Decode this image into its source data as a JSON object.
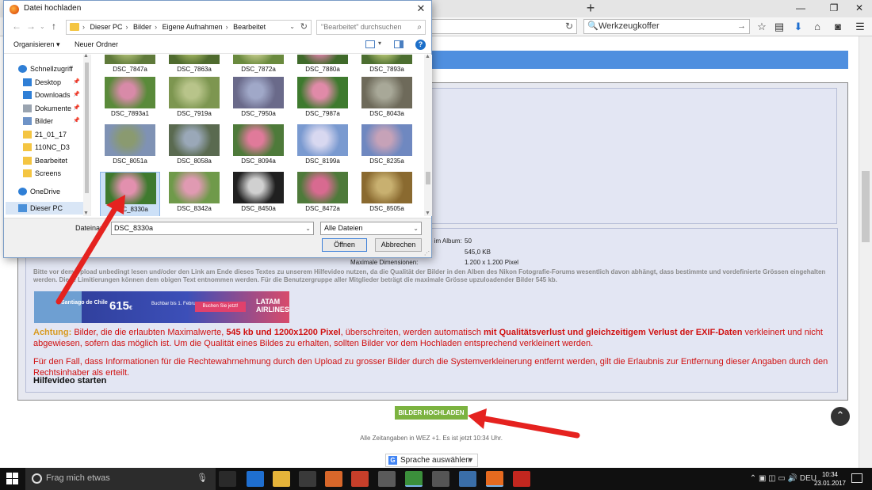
{
  "browser": {
    "new_tab_label": "+",
    "search_text": "Werkzeugkoffer",
    "window_controls": {
      "minimize": "—",
      "maximize": "❐",
      "close": "✕"
    }
  },
  "dialog": {
    "title": "Datei hochladen",
    "close_label": "✕",
    "breadcrumb": [
      "Dieser PC",
      "Bilder",
      "Eigene Aufnahmen",
      "Bearbeitet"
    ],
    "search_placeholder": "\"Bearbeitet\" durchsuchen",
    "toolbar": {
      "organize": "Organisieren ▾",
      "new_folder": "Neuer Ordner",
      "help": "?"
    },
    "nav_items": [
      {
        "label": "Schnellzugriff",
        "icon": "star-icon",
        "color": "#2f7fd6",
        "pinned": false
      },
      {
        "label": "Desktop",
        "icon": "desktop-icon",
        "color": "#2f7fd6",
        "pinned": true
      },
      {
        "label": "Downloads",
        "icon": "download-icon",
        "color": "#2f7fd6",
        "pinned": true
      },
      {
        "label": "Dokumente",
        "icon": "document-icon",
        "color": "#9aa4b0",
        "pinned": true
      },
      {
        "label": "Bilder",
        "icon": "pictures-icon",
        "color": "#6e93c7",
        "pinned": true
      },
      {
        "label": "21_01_17",
        "icon": "folder-icon",
        "color": "#f4c542",
        "pinned": false
      },
      {
        "label": "110NC_D3",
        "icon": "folder-icon",
        "color": "#f4c542",
        "pinned": false
      },
      {
        "label": "Bearbeitet",
        "icon": "folder-icon",
        "color": "#f4c542",
        "pinned": false
      },
      {
        "label": "Screens",
        "icon": "folder-icon",
        "color": "#f4c542",
        "pinned": false
      },
      {
        "label": "OneDrive",
        "icon": "cloud-icon",
        "color": "#2f7fd6",
        "pinned": false
      },
      {
        "label": "Dieser PC",
        "icon": "computer-icon",
        "color": "#4a90d9",
        "pinned": false
      }
    ],
    "files": [
      {
        "name": "DSC_7847a",
        "colors": [
          "#5f7a3a",
          "#a8b870"
        ]
      },
      {
        "name": "DSC_7863a",
        "colors": [
          "#4f6b2e",
          "#9db05e"
        ]
      },
      {
        "name": "DSC_7872a",
        "colors": [
          "#6a8a3e",
          "#c0c888"
        ]
      },
      {
        "name": "DSC_7880a",
        "colors": [
          "#3f6a2a",
          "#d67fa2"
        ]
      },
      {
        "name": "DSC_7893a",
        "colors": [
          "#4c6e30",
          "#b0c070"
        ]
      },
      {
        "name": "DSC_7893a1",
        "colors": [
          "#5a8a3a",
          "#d88aa8"
        ]
      },
      {
        "name": "DSC_7919a",
        "colors": [
          "#7d9650",
          "#b8c48a"
        ]
      },
      {
        "name": "DSC_7950a",
        "colors": [
          "#6a6a8a",
          "#a0a8c8"
        ]
      },
      {
        "name": "DSC_7987a",
        "colors": [
          "#3e7a2e",
          "#e08aa8"
        ]
      },
      {
        "name": "DSC_8043a",
        "colors": [
          "#6e6a5a",
          "#a8a898"
        ]
      },
      {
        "name": "DSC_8051a",
        "colors": [
          "#7f92b4",
          "#8a9a70"
        ]
      },
      {
        "name": "DSC_8058a",
        "colors": [
          "#5a6a50",
          "#9aa8b8"
        ]
      },
      {
        "name": "DSC_8094a",
        "colors": [
          "#4e7a3a",
          "#e07a9a"
        ]
      },
      {
        "name": "DSC_8199a",
        "colors": [
          "#7a9ad0",
          "#d8d8f0"
        ]
      },
      {
        "name": "DSC_8235a",
        "colors": [
          "#6f88c0",
          "#c6a2b8"
        ]
      },
      {
        "name": "DSC_8330a",
        "colors": [
          "#3f7a2e",
          "#e290ae"
        ]
      },
      {
        "name": "DSC_8342a",
        "colors": [
          "#6f9a4a",
          "#e09ab2"
        ]
      },
      {
        "name": "DSC_8450a",
        "colors": [
          "#202020",
          "#d0d0d0"
        ]
      },
      {
        "name": "DSC_8472a",
        "colors": [
          "#4e7a3a",
          "#d86a90"
        ]
      },
      {
        "name": "DSC_8505a",
        "colors": [
          "#8a6a30",
          "#c8b070"
        ]
      }
    ],
    "selected_file": "DSC_8330a",
    "filename_label": "Dateinam",
    "filename_value": "DSC_8330a",
    "filetype_value": "Alle Dateien",
    "open_label": "Öffnen",
    "cancel_label": "Abbrechen"
  },
  "info": {
    "images_label": "e im Album:",
    "images_value": "50",
    "size_value": "545,0 KB",
    "maxdim_label": "Maximale Dimensionen:",
    "maxdim_value": "1.200 x 1.200 Pixel",
    "notice": "Bitte vor dem Upload unbedingt lesen und/oder den Link am Ende dieses Textes zu unserem Hilfevideo nutzen, da die Qualität der Bilder in den Alben des Nikon Fotografie-Forums wesentlich davon abhängt, dass bestimmte und vordefinierte Grössen eingehalten werden. Diese Limitierungen können dem obigen Text entnommen werden. Für die Benutzergruppe aller Mitglieder beträgt die maximale Grösse upzuloadender Bilder 545 kb."
  },
  "ad": {
    "city": "Santiago de Chile",
    "price": "615",
    "currency": "€",
    "subtext": "Buchbar bis 1. Februar",
    "cta": "Buchen Sie jetzt!",
    "brand": "LATAM AIRLINES"
  },
  "warning": {
    "p1_a": "Achtung:",
    "p1_b": " Bilder, die die erlaubten Maximalwerte, ",
    "p1_c": "545 kb und 1200x1200 Pixel",
    "p1_d": ", überschreiten, werden automatisch ",
    "p1_e": "mit Qualitätsverlust und gleichzeitigem Verlust der EXIF-Daten",
    "p1_f": " verkleinert und nicht abgewiesen, sofern das möglich ist. Um die Qualität eines Bildes zu erhalten, sollten Bilder vor dem Hochladen entsprechend verkleinert werden.",
    "p2": "Für den Fall, dass Informationen für die Rechtewahrnehmung durch den Upload zu grosser Bilder durch die Systemverkleinerung entfernt werden, gilt die Erlaubnis zur Entfernung dieser Angaben durch den Rechtsinhaber als erteilt.",
    "link": "Hilfevideo starten"
  },
  "upload_label": "BILDER HOCHLADEN",
  "timezone_text": "Alle Zeitangaben in WEZ +1. Es ist jetzt 10:34 Uhr.",
  "language_label": "Sprache auswählen",
  "taskbar": {
    "search_placeholder": "Frag mich etwas",
    "lang": "DEU",
    "time": "10:34",
    "date": "23.01.2017",
    "apps": [
      {
        "name": "task-view-icon",
        "color": "#2a2a2a"
      },
      {
        "name": "edge-icon",
        "color": "#1f6fd0"
      },
      {
        "name": "explorer-icon",
        "color": "#e6b43a"
      },
      {
        "name": "store-icon",
        "color": "#3a3a3a"
      },
      {
        "name": "photo-app-icon",
        "color": "#d8672a"
      },
      {
        "name": "gallery-icon",
        "color": "#c73f2a"
      },
      {
        "name": "settings-icon",
        "color": "#5a5a5a"
      },
      {
        "name": "chrome-icon",
        "color": "#3b8f3b"
      },
      {
        "name": "recycle-icon",
        "color": "#555555"
      },
      {
        "name": "monitor-icon",
        "color": "#3a6ea8"
      },
      {
        "name": "firefox-icon",
        "color": "#e66a1f"
      },
      {
        "name": "acrobat-icon",
        "color": "#c3271f"
      }
    ]
  },
  "colors": {
    "arrow": "#e5221f",
    "upload_green": "#7cb340",
    "blue_band": "#4f8fdf",
    "warning_red": "#d01010"
  }
}
